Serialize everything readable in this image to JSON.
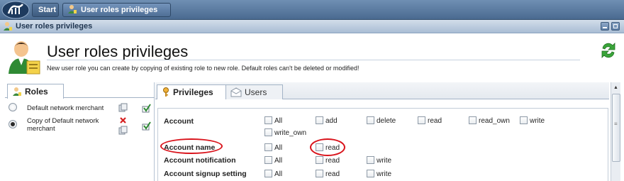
{
  "taskbar": {
    "start_label": "Start",
    "tab_label": "User roles privileges",
    "tab_close": "×"
  },
  "window": {
    "title": "User roles privileges"
  },
  "header": {
    "title": "User roles privileges",
    "subtitle": "New user role you can create by copying of existing role to new role. Default roles can't be deleted or modified!"
  },
  "roles": {
    "tab_label": "Roles",
    "items": [
      {
        "label": "Default network merchant",
        "selected": false
      },
      {
        "label": "Copy of Default network merchant",
        "selected": true
      }
    ]
  },
  "privileges": {
    "tabs": [
      {
        "label": "Privileges",
        "active": true
      },
      {
        "label": "Users",
        "active": false
      }
    ],
    "rows": [
      {
        "name": "Account",
        "perms": [
          "All",
          "add",
          "delete",
          "read",
          "read_own",
          "write",
          "write_own"
        ]
      },
      {
        "name": "Account name",
        "perms": [
          "All",
          "read"
        ]
      },
      {
        "name": "Account notification",
        "perms": [
          "All",
          "read",
          "write"
        ]
      },
      {
        "name": "Account signup setting",
        "perms": [
          "All",
          "read",
          "write"
        ]
      }
    ]
  },
  "scrollbar": {
    "up_glyph": "▲"
  },
  "colors": {
    "taskbar": "#4a6a90",
    "title_bar": "#a9bdd4",
    "highlight_ellipse": "#d9141c"
  }
}
